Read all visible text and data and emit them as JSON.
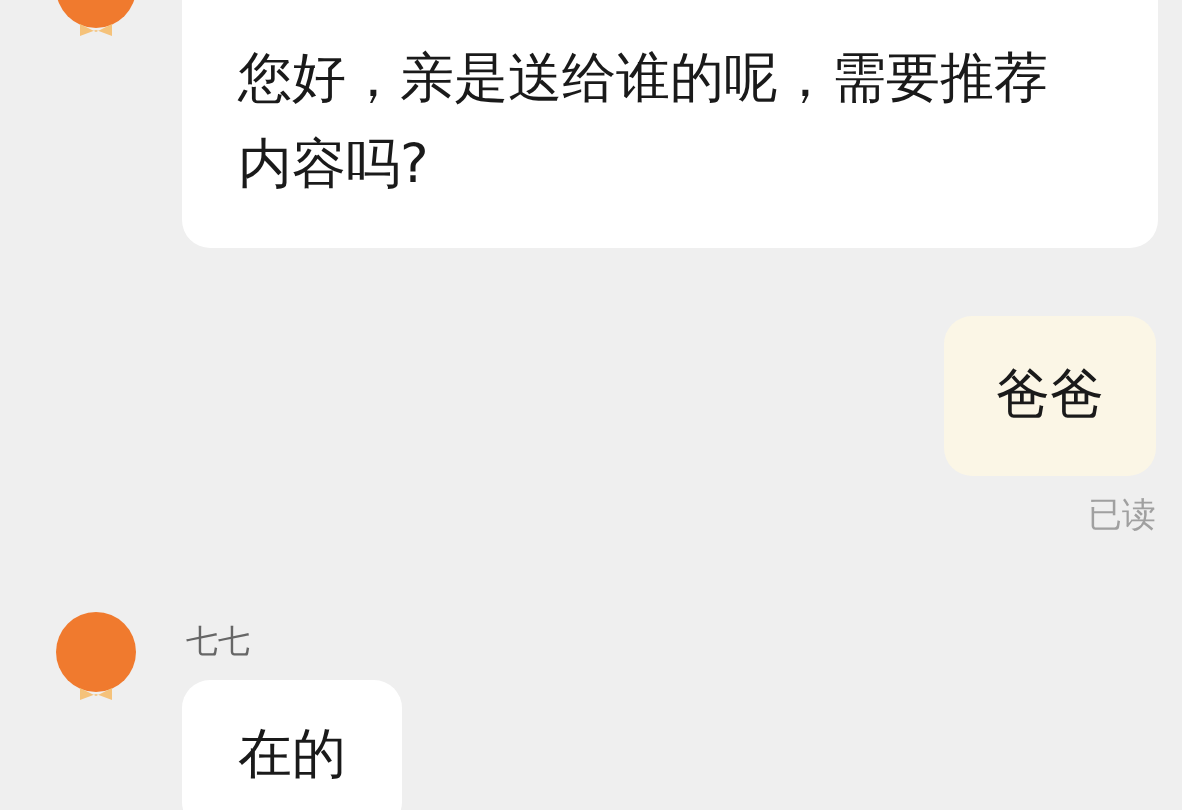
{
  "messages": [
    {
      "kind": "incoming",
      "text": "您好，亲是送给谁的呢，需要推荐内容吗?"
    },
    {
      "kind": "outgoing",
      "text": "爸爸",
      "status": "已读"
    },
    {
      "kind": "incoming",
      "sender": "七七",
      "text": "在的"
    }
  ]
}
